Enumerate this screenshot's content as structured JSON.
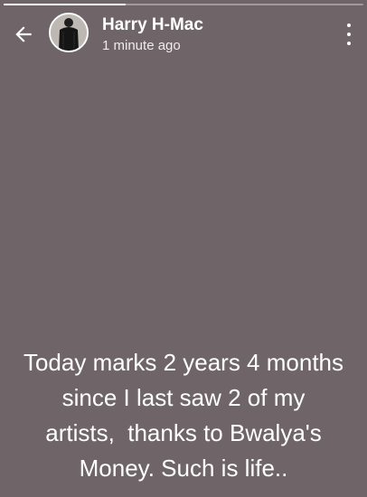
{
  "story": {
    "progress": 0.34,
    "background_color": "#6f6568"
  },
  "header": {
    "back_icon": "arrow-left-icon",
    "user_name": "Harry H-Mac",
    "timestamp": "1 minute ago",
    "menu_icon": "more-vertical-icon"
  },
  "status": {
    "text": "Today marks 2 years 4 months\nsince I last saw 2 of my\nartists,  thanks to Bwalya's\nMoney. Such is life.."
  }
}
